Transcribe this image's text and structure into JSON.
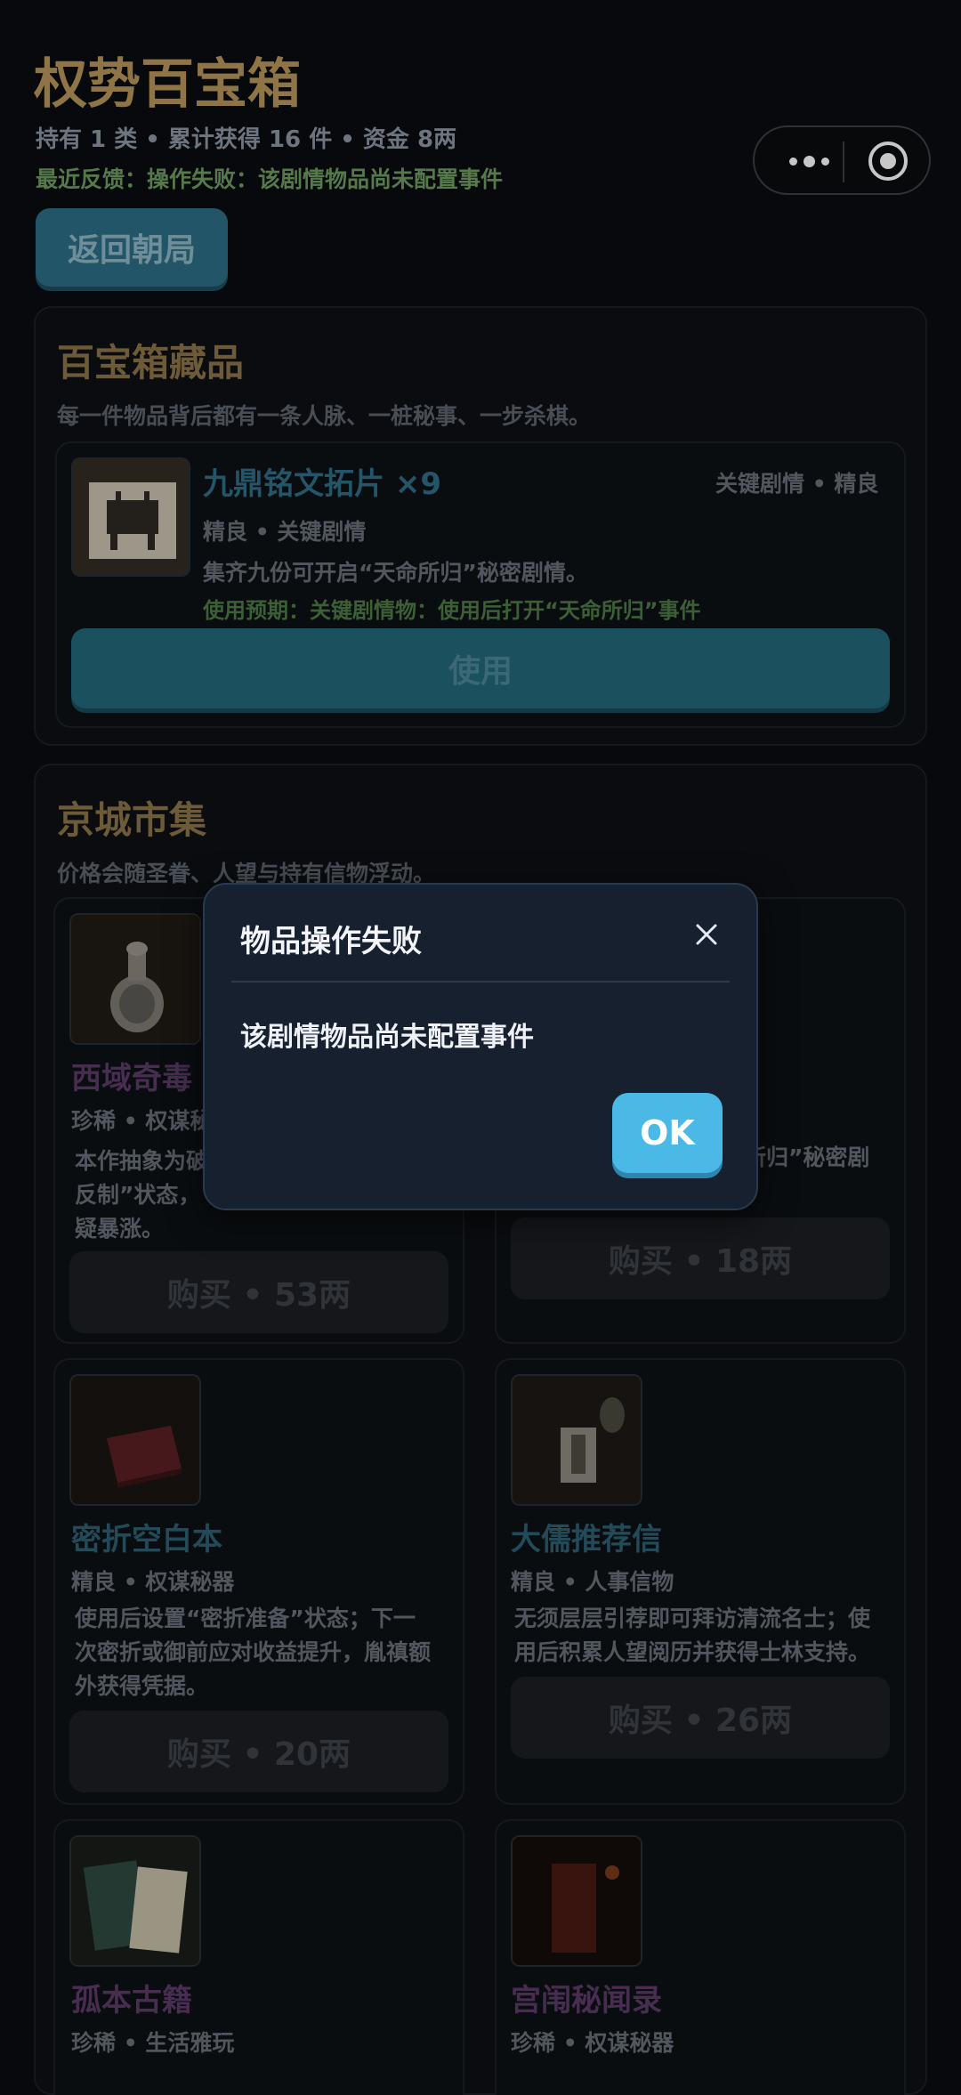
{
  "header": {
    "title": "权势百宝箱",
    "stats": "持有 1 类 • 累计获得 16 件 • 资金 8两",
    "feedback": "最近反馈：操作失败：该剧情物品尚未配置事件"
  },
  "back_button": "返回朝局",
  "inventory": {
    "title": "百宝箱藏品",
    "subtitle": "每一件物品背后都有一条人脉、一桩秘事、一步杀棋。",
    "item": {
      "name": "九鼎铭文拓片 ×9",
      "tags_right": "关键剧情 • 精良",
      "meta": "精良 • 关键剧情",
      "desc": "集齐九份可开启“天命所归”秘密剧情。",
      "expect": "使用预期：关键剧情物：使用后打开“天命所归”事件",
      "use_label": "使用"
    }
  },
  "market": {
    "title": "京城市集",
    "subtitle": "价格会随圣眷、人望与持有信物浮动。",
    "items": [
      {
        "name": "西域奇毒",
        "meta": "珍稀 • 权谋秘",
        "desc_lines": [
          "本作抽象为破",
          "反制”状态，",
          "疑暴涨。"
        ],
        "buy": "购买 • 53两",
        "color": "#5b3a66"
      },
      {
        "name": "",
        "meta": "",
        "desc_lines": [
          "所归”秘密剧"
        ],
        "buy": "购买 • 18两",
        "color": "#2c5f72"
      },
      {
        "name": "密折空白本",
        "meta": "精良 • 权谋秘器",
        "desc_lines": [
          "使用后设置“密折准备”状态；下一",
          "次密折或御前应对收益提升，胤禛额",
          "外获得凭据。"
        ],
        "buy": "购买 • 20两",
        "color": "#2c5f72"
      },
      {
        "name": "大儒推荐信",
        "meta": "精良 • 人事信物",
        "desc_lines": [
          "无须层层引荐即可拜访清流名士；使",
          "用后积累人望阅历并获得士林支持。"
        ],
        "buy": "购买 • 26两",
        "color": "#2c5f72"
      },
      {
        "name": "孤本古籍",
        "meta": "珍稀 • 生活雅玩",
        "desc_lines": [],
        "buy": "",
        "color": "#5b3a66"
      },
      {
        "name": "宫闱秘闻录",
        "meta": "珍稀 • 权谋秘器",
        "desc_lines": [],
        "buy": "",
        "color": "#5b3a66"
      }
    ]
  },
  "modal": {
    "title": "物品操作失败",
    "message": "该剧情物品尚未配置事件",
    "ok_label": "OK"
  },
  "colors": {
    "background": "#0a0c10",
    "accent_gold": "#b8965a",
    "teal_button": "#2c6e86",
    "ok_button": "#4ab9e6",
    "rare_purple": "#5b3a66"
  }
}
